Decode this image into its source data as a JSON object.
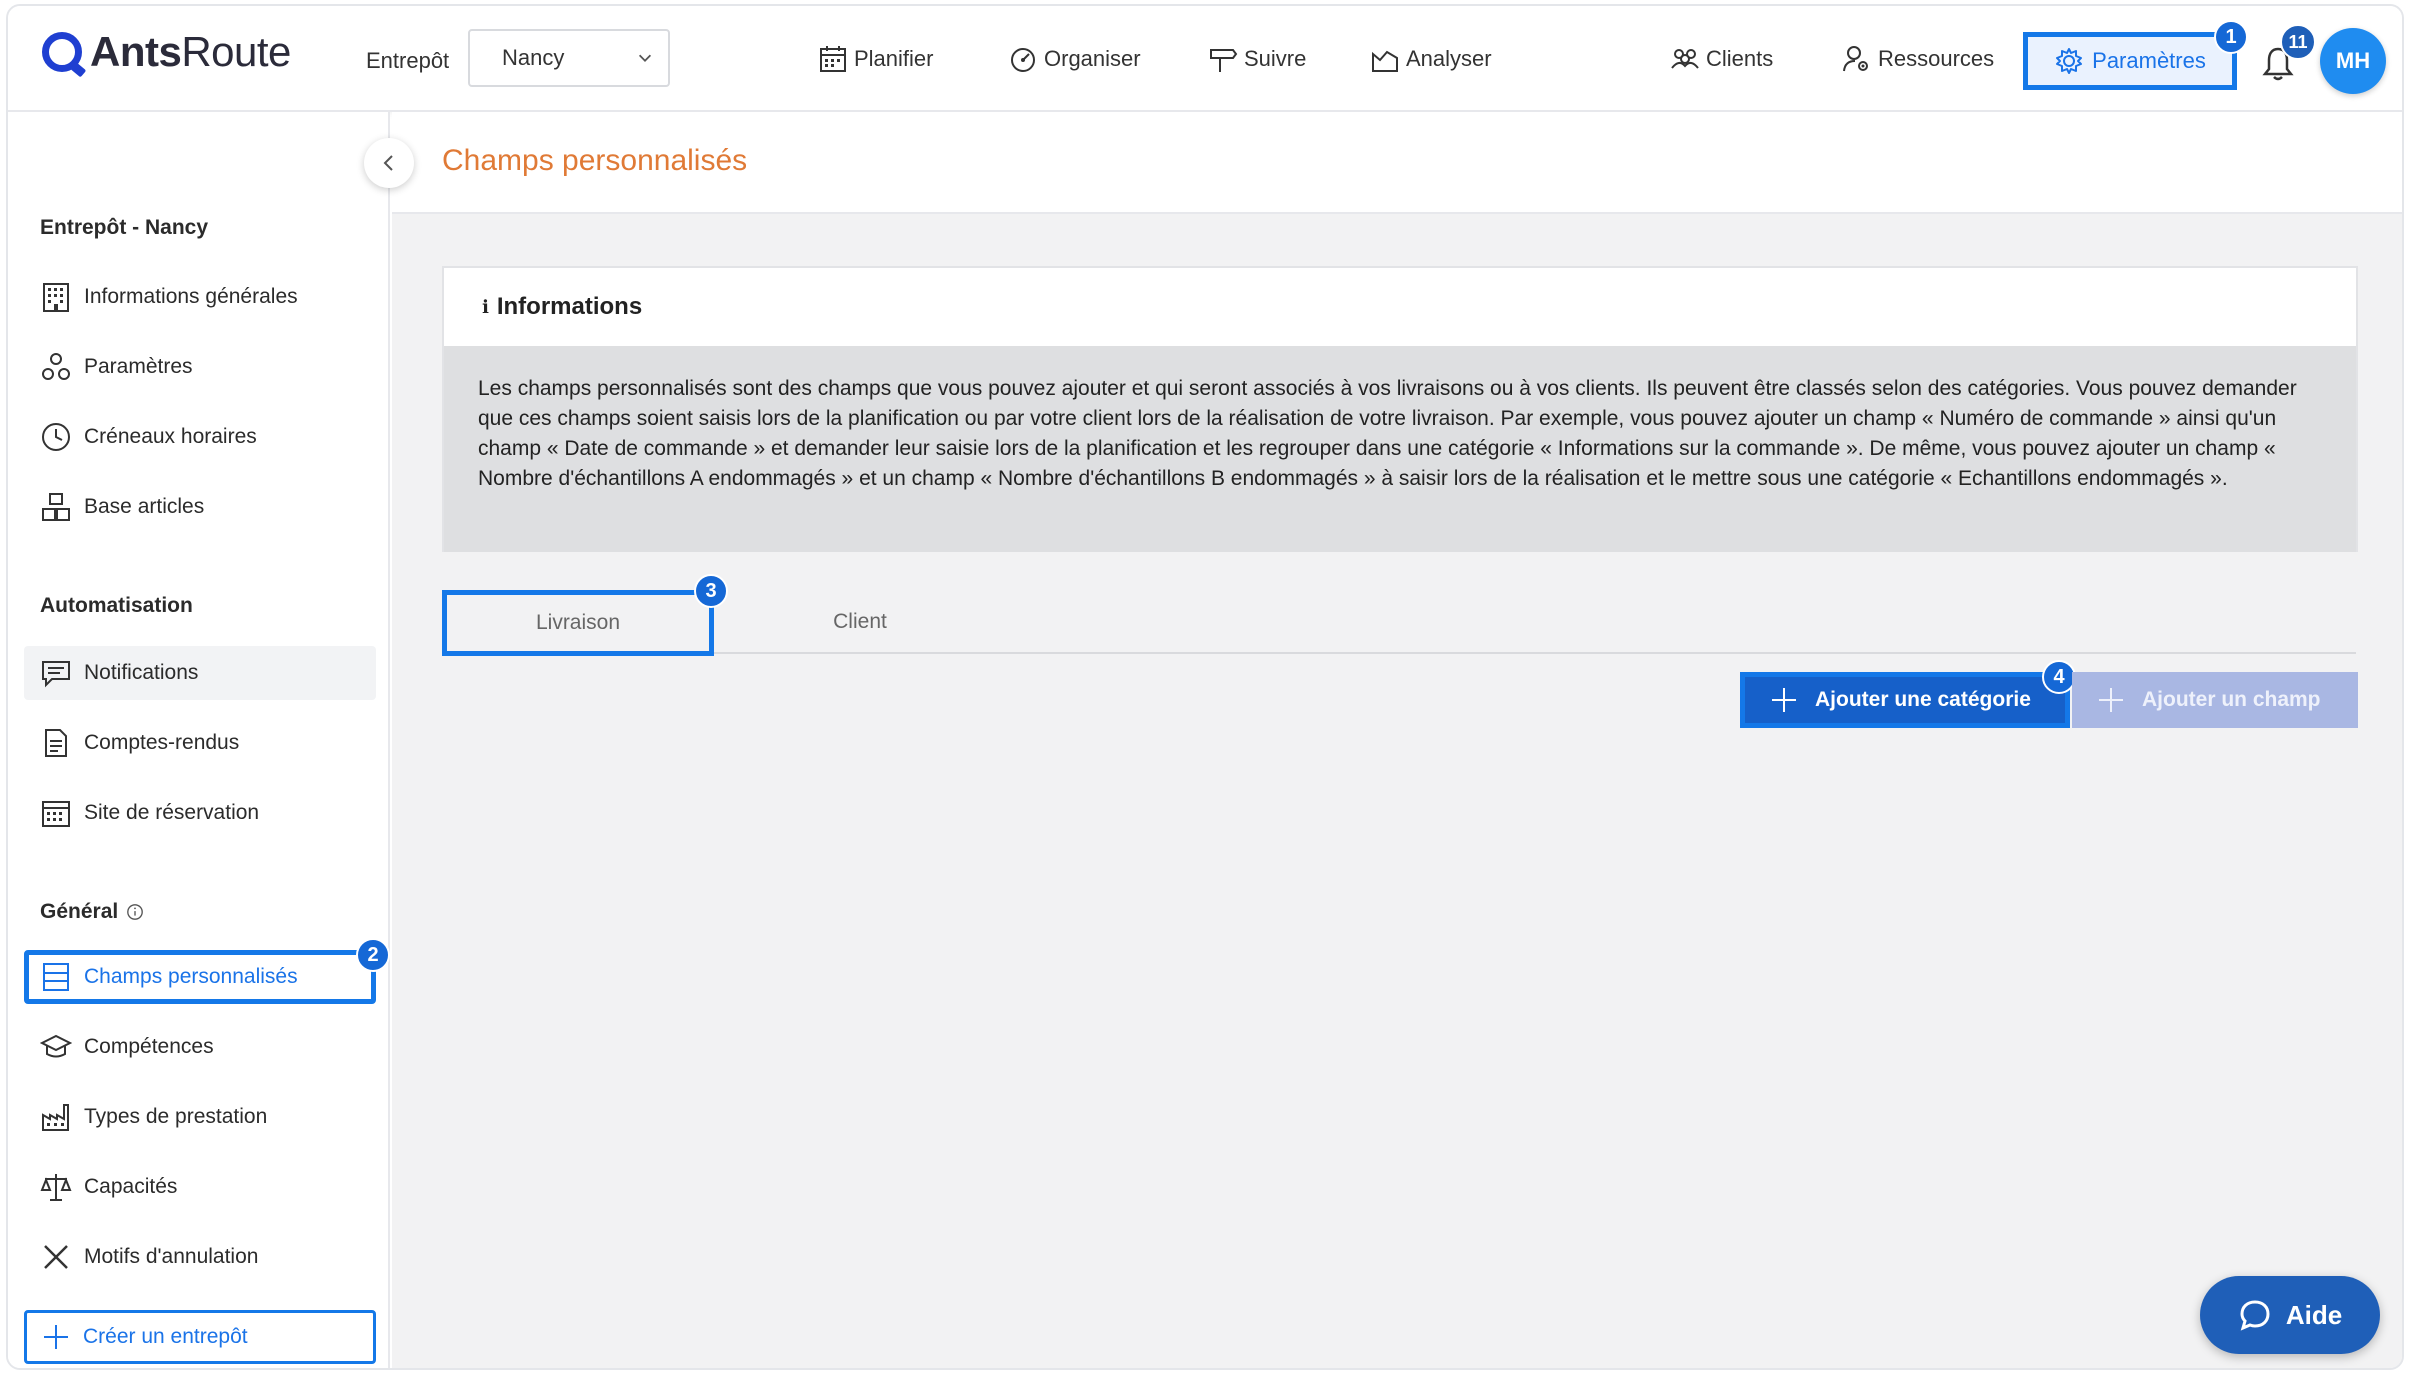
{
  "brand": {
    "name_bold": "Ants",
    "name_light": "Route"
  },
  "header": {
    "warehouse_label": "Entrepôt",
    "warehouse_value": "Nancy",
    "nav": {
      "planifier": "Planifier",
      "organiser": "Organiser",
      "suivre": "Suivre",
      "analyser": "Analyser",
      "clients": "Clients",
      "ressources": "Ressources",
      "parametres": "Paramètres"
    },
    "notification_count": "11",
    "avatar_initials": "MH"
  },
  "step_badges": {
    "one": "1",
    "two": "2",
    "three": "3",
    "four": "4"
  },
  "sidebar": {
    "warehouse_section": "Entrepôt - Nancy",
    "items_warehouse": {
      "infos": "Informations générales",
      "parametres": "Paramètres",
      "creneaux": "Créneaux horaires",
      "articles": "Base articles"
    },
    "automation_section": "Automatisation",
    "items_automation": {
      "notifications": "Notifications",
      "comptes_rendus": "Comptes-rendus",
      "reservation": "Site de réservation"
    },
    "general_section": "Général",
    "items_general": {
      "champs": "Champs personnalisés",
      "competences": "Compétences",
      "prestations": "Types de prestation",
      "capacites": "Capacités",
      "motifs": "Motifs d'annulation"
    },
    "create_warehouse": "Créer un entrepôt"
  },
  "main": {
    "title": "Champs personnalisés",
    "info_title": "Informations",
    "info_text": "Les champs personnalisés sont des champs que vous pouvez ajouter et qui seront associés à vos livraisons ou à vos clients. Ils peuvent être classés selon des catégories. Vous pouvez demander que ces champs soient saisis lors de la planification ou par votre client lors de la réalisation de votre livraison. Par exemple, vous pouvez ajouter un champ « Numéro de commande » ainsi qu'un champ « Date de commande » et demander leur saisie lors de la planification et les regrouper dans une catégorie « Informations sur la commande ». De même, vous pouvez ajouter un champ « Nombre d'échantillons A endommagés » et un champ « Nombre d'échantillons B endommagés » à saisir lors de la réalisation et le mettre sous une catégorie « Echantillons endommagés ».",
    "tabs": {
      "delivery": "Livraison",
      "client": "Client"
    },
    "add_category": "Ajouter une catégorie",
    "add_field": "Ajouter un champ"
  },
  "help": {
    "label": "Aide"
  },
  "colors": {
    "accent": "#1478e8",
    "title": "#e07a36",
    "primary_button": "#1660c9",
    "disabled_button": "#a9b7e3"
  }
}
